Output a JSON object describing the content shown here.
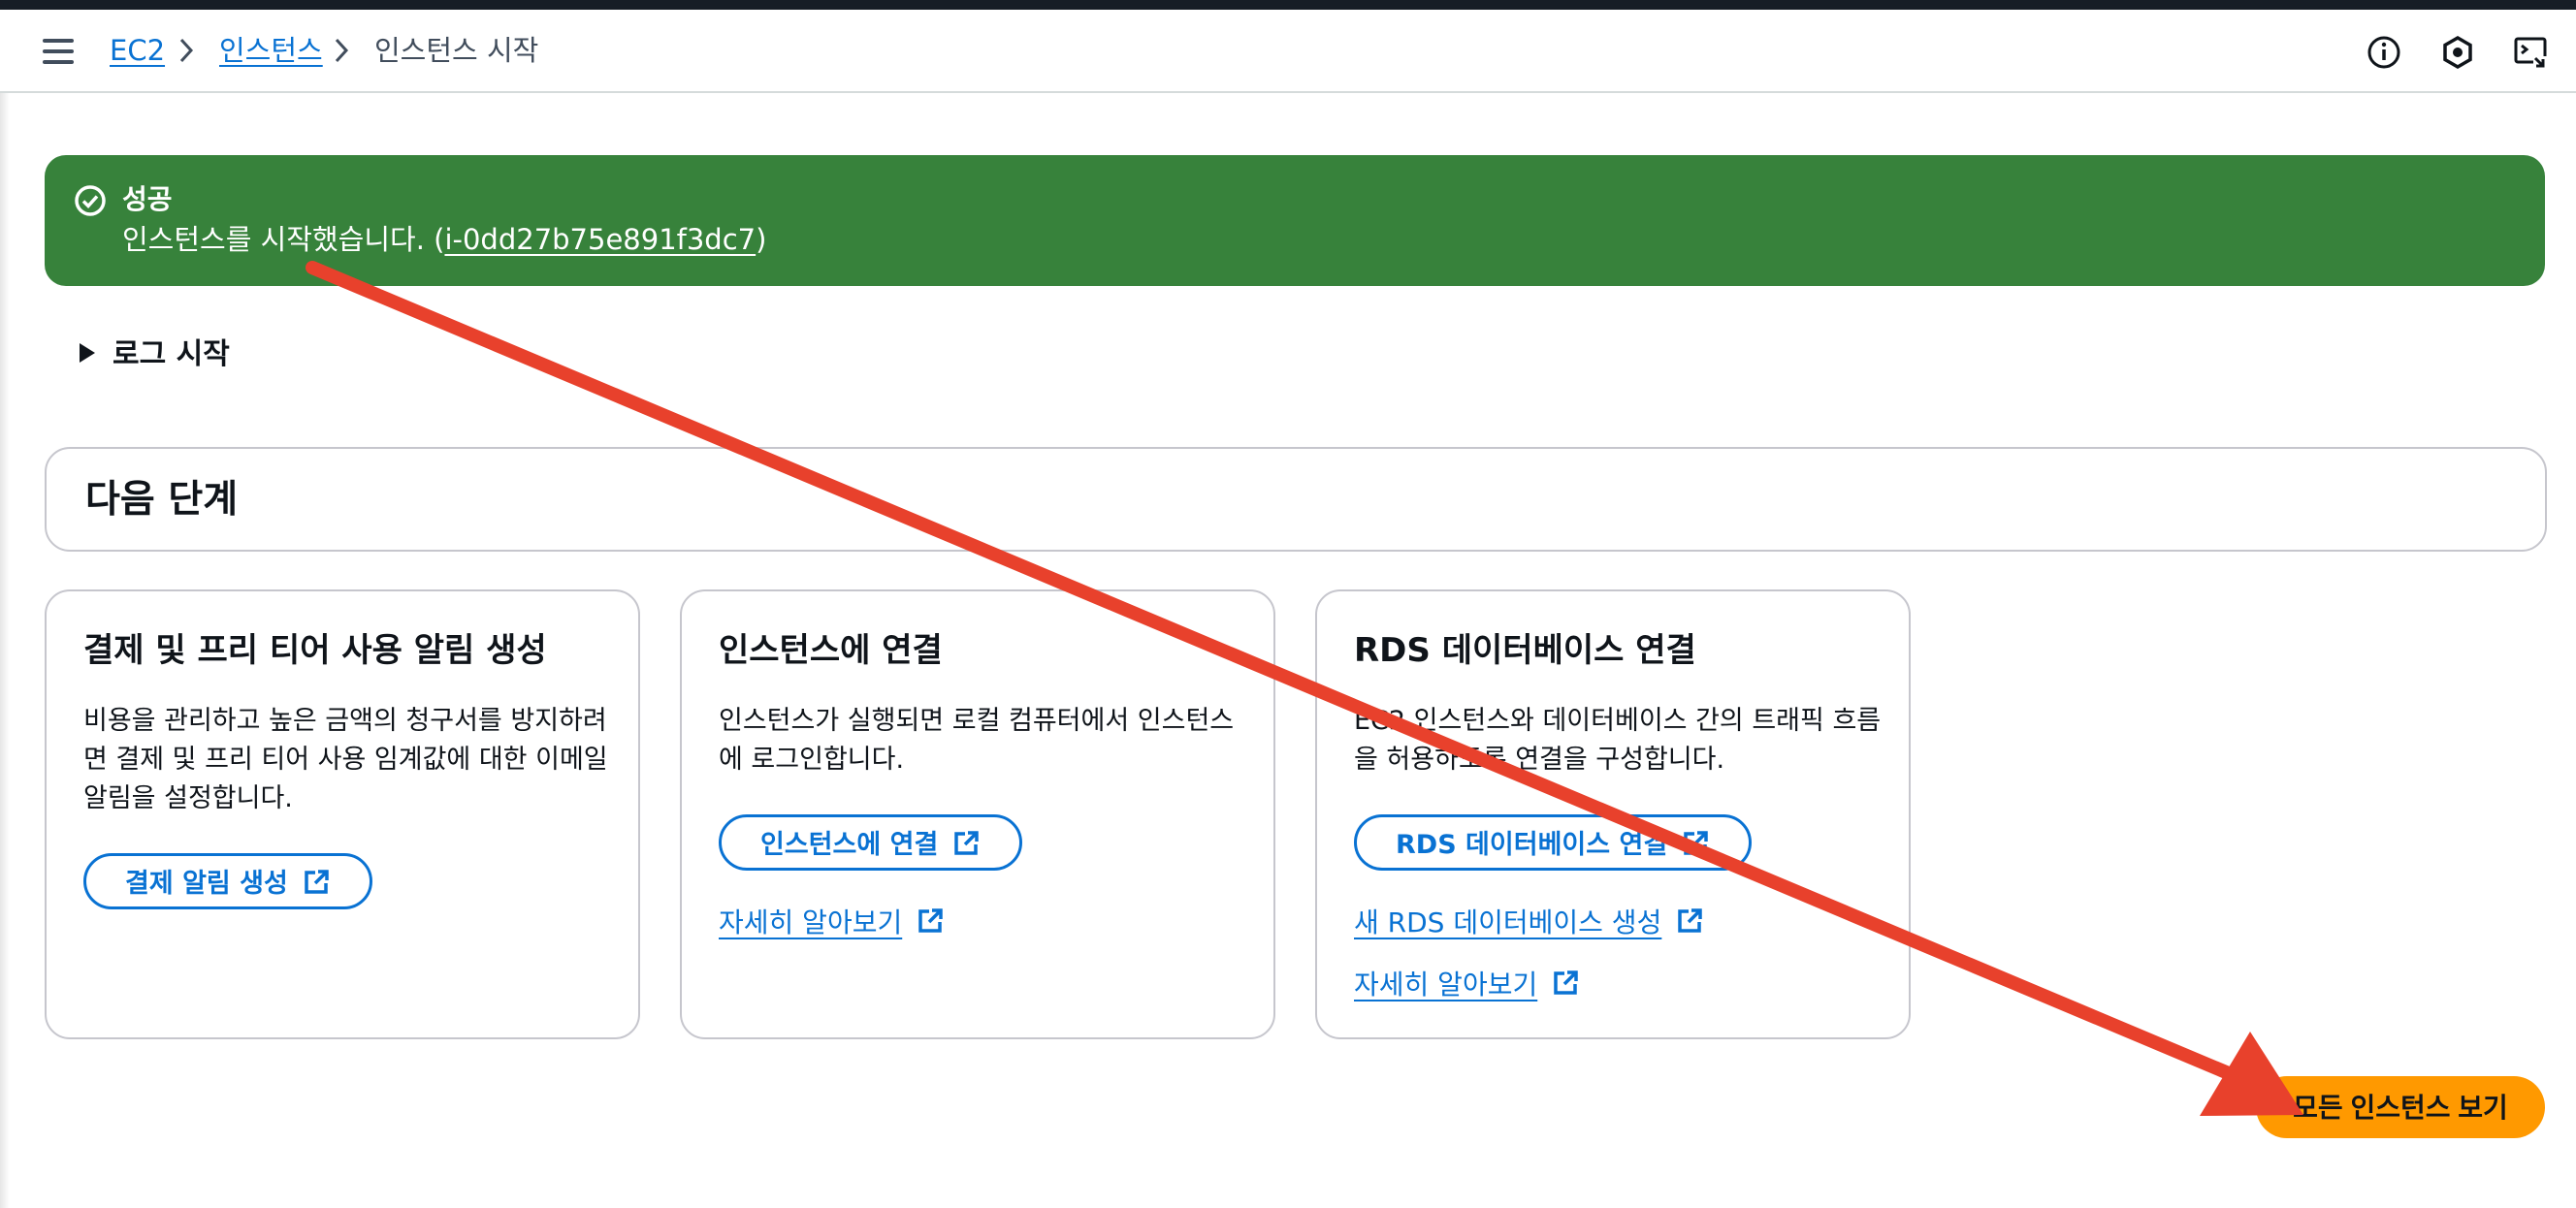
{
  "header": {
    "breadcrumb": [
      "EC2",
      "인스턴스",
      "인스턴스 시작"
    ],
    "icons": [
      "menu-icon",
      "info-icon",
      "settings-icon",
      "cloudshell-icon"
    ]
  },
  "flash": {
    "type": "success",
    "title": "성공",
    "message_prefix": "인스턴스를 시작했습니다. (",
    "instance_id": "i-0dd27b75e891f3dc7",
    "message_suffix": ")",
    "color": "#37823b"
  },
  "log_expander": {
    "label": "로그 시작"
  },
  "next_steps": {
    "title": "다음 단계",
    "cards": [
      {
        "title": "결제 및 프리 티어 사용 알림 생성",
        "desc_lines": [
          "비용을 관리하고 높은 금액의 청구서를 방지하려",
          "면 결제 및 프리 티어 사용 임계값에 대한 이메일",
          "알림을 설정합니다."
        ],
        "button": "결제 알림 생성"
      },
      {
        "title": "인스턴스에 연결",
        "desc_lines": [
          "인스턴스가 실행되면 로컬 컴퓨터에서 인스턴스",
          "에 로그인합니다."
        ],
        "button": "인스턴스에 연결",
        "links": [
          "자세히 알아보기"
        ]
      },
      {
        "title": "RDS 데이터베이스 연결",
        "desc_lines": [
          "EC2 인스턴스와 데이터베이스 간의 트래픽 흐름",
          "을 허용하도록 연결을 구성합니다."
        ],
        "button": "RDS 데이터베이스 연결",
        "links": [
          "새 RDS 데이터베이스 생성",
          "자세히 알아보기"
        ]
      }
    ]
  },
  "primary_button": {
    "label": "모든 인스턴스 보기",
    "color": "#ff9900"
  },
  "annotation": {
    "color": "#e8412c"
  }
}
